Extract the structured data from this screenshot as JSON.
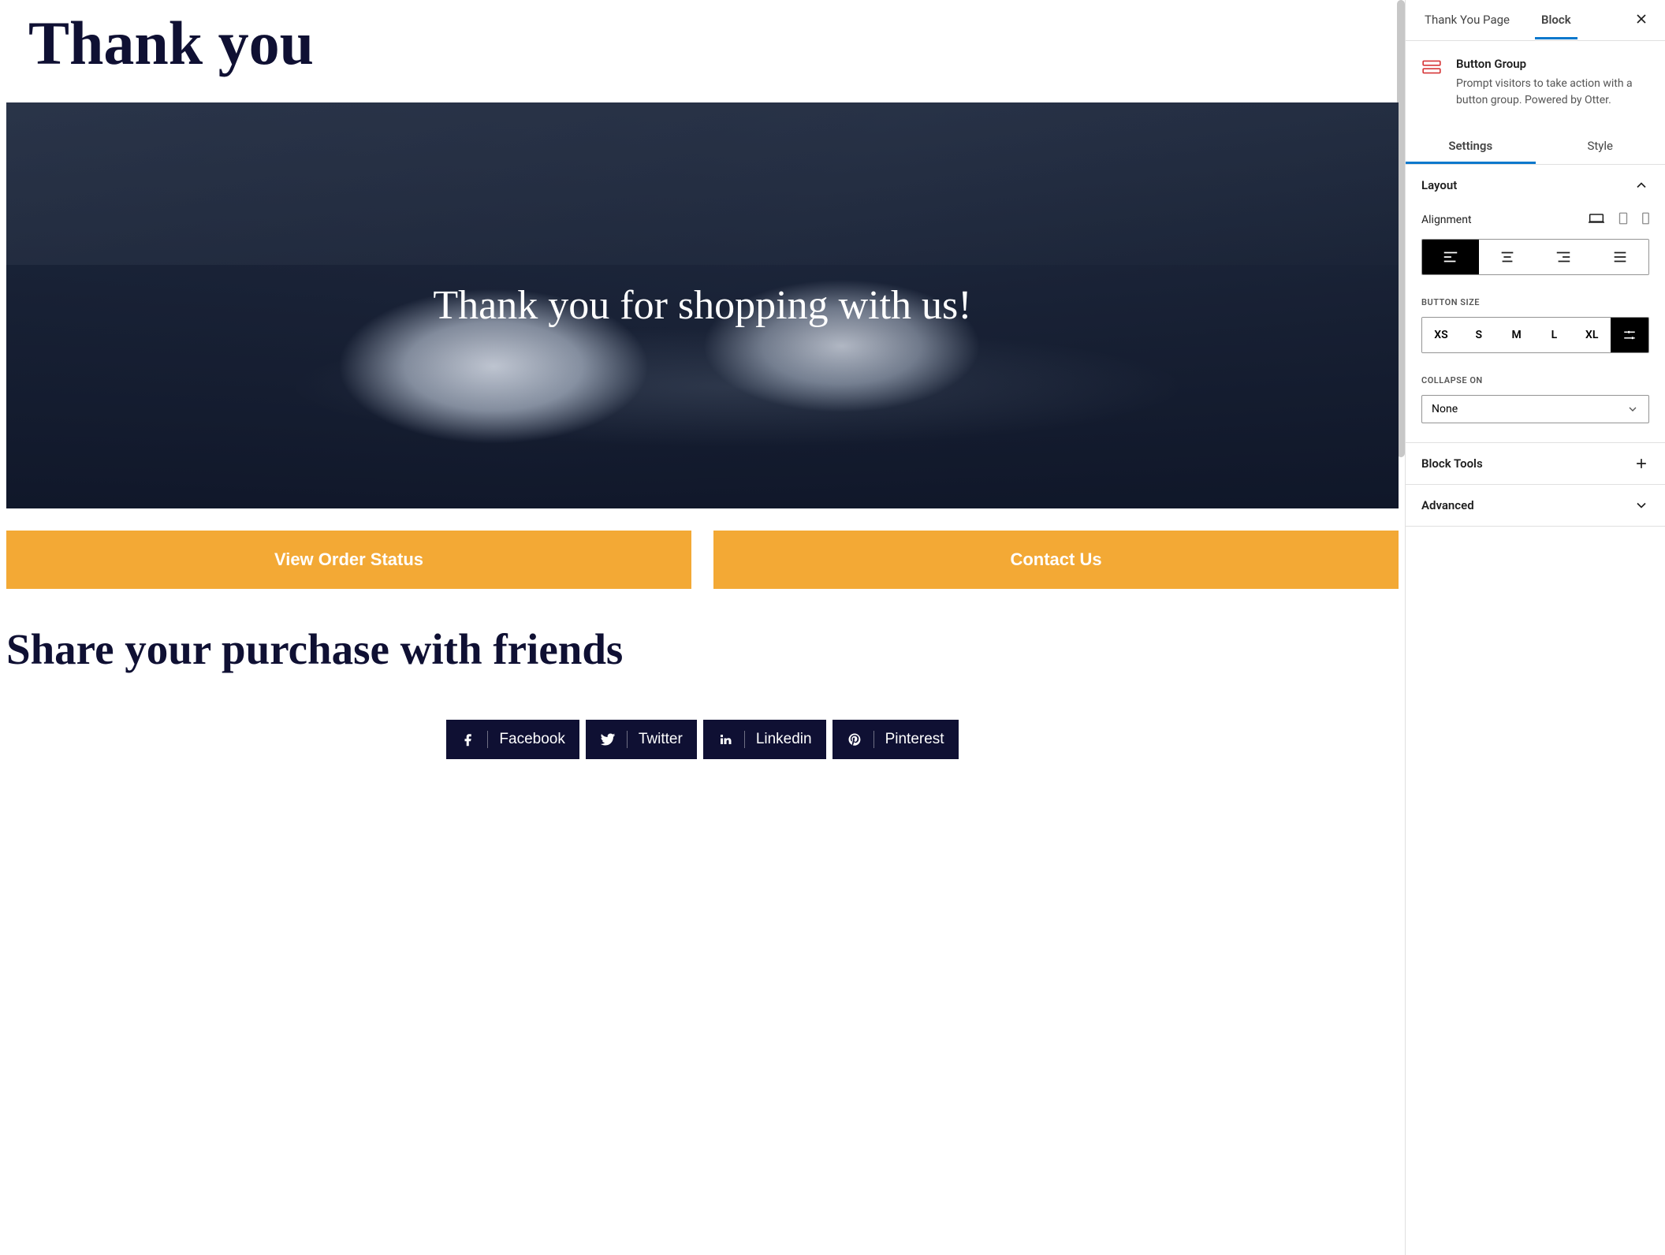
{
  "page": {
    "title": "Thank you",
    "hero_text": "Thank you for shopping with us!",
    "cta_buttons": [
      {
        "label": "View Order Status"
      },
      {
        "label": "Contact Us"
      }
    ],
    "share_heading": "Share your purchase with friends",
    "social": [
      {
        "name": "Facebook"
      },
      {
        "name": "Twitter"
      },
      {
        "name": "Linkedin"
      },
      {
        "name": "Pinterest"
      }
    ]
  },
  "sidebar": {
    "tabs": {
      "page": "Thank You Page",
      "block": "Block"
    },
    "block": {
      "name": "Button Group",
      "description": "Prompt visitors to take action with a button group. Powered by Otter."
    },
    "secondary_tabs": {
      "settings": "Settings",
      "style": "Style"
    },
    "panels": {
      "layout": {
        "title": "Layout",
        "alignment_label": "Alignment",
        "button_size_label": "BUTTON SIZE",
        "sizes": [
          "XS",
          "S",
          "M",
          "L",
          "XL"
        ],
        "collapse_label": "COLLAPSE ON",
        "collapse_value": "None"
      },
      "block_tools": "Block Tools",
      "advanced": "Advanced"
    }
  }
}
